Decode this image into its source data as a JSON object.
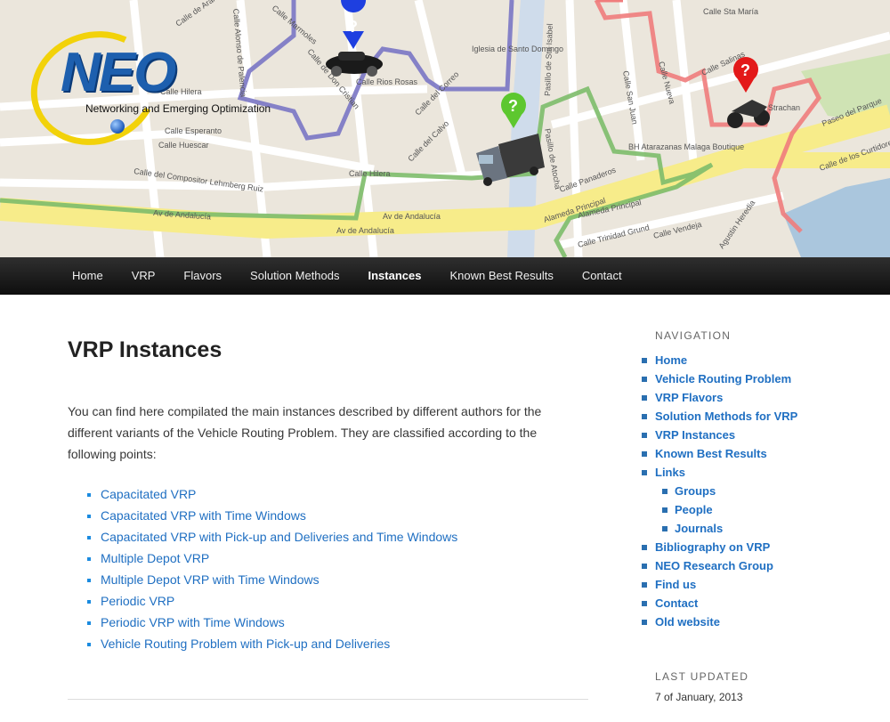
{
  "header": {
    "logo_text": "NEO",
    "logo_subtitle": "Networking and Emerging Optimization",
    "map_labels": {
      "calle_hilera_1": "Calle Hilera",
      "calle_esperanto": "Calle Esperanto",
      "calle_huescar": "Calle Huescar",
      "calle_compositor": "Calle del Compositor Lehmberg Ruiz",
      "av_andalucia_1": "Av de Andalucía",
      "av_andalucia_2": "Av de Andalucía",
      "av_andalucia_3": "Av de Andalucía",
      "calle_hilera_2": "Calle Hilera",
      "calle_rios_rosas": "Calle Rios Rosas",
      "calle_don_cristian": "Calle de Don Cristian",
      "calle_correo": "Calle del Correo",
      "calle_calvo": "Calle del Calvo",
      "iglesia": "Iglesia de Santo Domingo",
      "pasillo_santa_isabel": "Pasillo de Sta Isabel",
      "pasillo_atocha": "Pasillo de Atocha",
      "alameda_1": "Alameda Principal",
      "alameda_2": "Alameda Principal",
      "calle_panaderos": "Calle Panaderos",
      "bh_atarazanas": "BH Atarazanas Malaga Boutique",
      "calle_trinidad": "Calle Trinidad Grund",
      "calle_vendeja": "Calle Vendeja",
      "calle_san_juan": "Calle San Juan",
      "calle_nueva": "Calle Nueva",
      "calle_sta_maria": "Calle Sta María",
      "calle_salinas": "Calle Salinas",
      "calle_strachan": "Calle Strachan",
      "paseo_parque": "Paseo del Parque",
      "calle_curtidores": "Calle de los Curtidores",
      "agustin_heredia": "Agustin Heredia",
      "calle_alonso": "Calle Alonso de Palencia",
      "calle_marmoles": "Calle Marmoles",
      "calle_arango": "Calle de Arango"
    },
    "colors": {
      "route_blue": "#7a76c4",
      "route_green": "#7dbd6a",
      "route_red": "#f07c7c",
      "main_road": "#f7ec8a",
      "water": "#aac6dd",
      "park": "#cfe3b4"
    }
  },
  "nav": {
    "items": [
      {
        "label": "Home"
      },
      {
        "label": "VRP"
      },
      {
        "label": "Flavors"
      },
      {
        "label": "Solution Methods"
      },
      {
        "label": "Instances"
      },
      {
        "label": "Known Best Results"
      },
      {
        "label": "Contact"
      }
    ],
    "active": "Instances"
  },
  "main": {
    "title": "VRP Instances",
    "intro": "You can find here compilated the main instances described by different authors for the different variants of the Vehicle Routing Problem. They are classified according to the following points:",
    "links": [
      {
        "label": "Capacitated VRP"
      },
      {
        "label": "Capacitated VRP with Time Windows"
      },
      {
        "label": "Capacitated VRP with Pick-up and Deliveries and Time Windows"
      },
      {
        "label": "Multiple Depot VRP"
      },
      {
        "label": "Multiple Depot VRP with Time Windows"
      },
      {
        "label": "Periodic VRP"
      },
      {
        "label": "Periodic VRP with Time Windows"
      },
      {
        "label": "Vehicle Routing Problem with Pick-up and Deliveries"
      }
    ]
  },
  "sidebar": {
    "navigation_title": "NAVIGATION",
    "nav": [
      {
        "label": "Home"
      },
      {
        "label": "Vehicle Routing Problem"
      },
      {
        "label": "VRP Flavors"
      },
      {
        "label": "Solution Methods for VRP"
      },
      {
        "label": "VRP Instances"
      },
      {
        "label": "Known Best Results"
      },
      {
        "label": "Links"
      }
    ],
    "sub": [
      {
        "label": "Groups"
      },
      {
        "label": "People"
      },
      {
        "label": "Journals"
      }
    ],
    "nav_after": [
      {
        "label": "Bibliography on VRP"
      },
      {
        "label": "NEO Research Group"
      },
      {
        "label": "Find us"
      },
      {
        "label": "Contact"
      },
      {
        "label": "Old website"
      }
    ],
    "updated_title": "LAST UPDATED",
    "updated_value": "7 of January, 2013"
  }
}
